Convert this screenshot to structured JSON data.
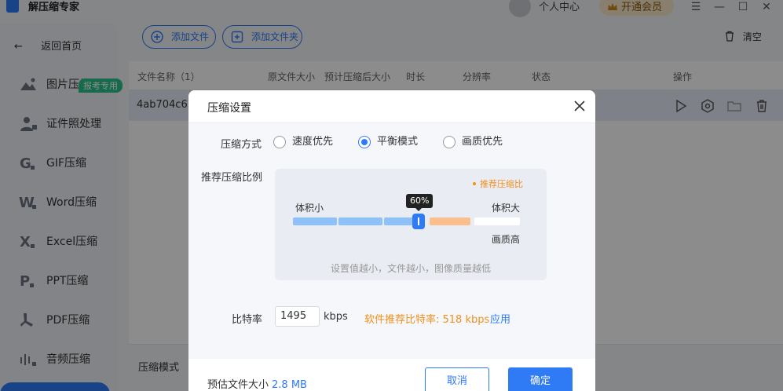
{
  "app": {
    "title": "解压缩专家",
    "user_center": "个人中心",
    "vip_label": "开通会员",
    "window_controls": [
      "menu-icon",
      "minimize-icon",
      "maximize-icon",
      "close-icon"
    ]
  },
  "sidebar": {
    "back_home": "返回首页",
    "items": [
      {
        "label": "图片压缩",
        "icon": "image-icon"
      },
      {
        "label": "证件照处理",
        "icon": "id-photo-icon",
        "badge": "报考专用"
      },
      {
        "label": "GIF压缩",
        "icon": "gif-icon"
      },
      {
        "label": "Word压缩",
        "icon": "word-icon"
      },
      {
        "label": "Excel压缩",
        "icon": "excel-icon"
      },
      {
        "label": "PPT压缩",
        "icon": "ppt-icon"
      },
      {
        "label": "PDF压缩",
        "icon": "pdf-icon"
      },
      {
        "label": "音频压缩",
        "icon": "audio-icon"
      }
    ]
  },
  "toolbar": {
    "add_file": "添加文件",
    "add_folder": "添加文件夹",
    "clear": "清空"
  },
  "table": {
    "headers": [
      "文件名称（1）",
      "原文件大小",
      "预计压缩后大小",
      "时长",
      "分辨率",
      "状态",
      "操作"
    ],
    "rows": [
      {
        "name": "4ab704c67"
      }
    ]
  },
  "bottom": {
    "mode_label": "压缩模式"
  },
  "dialog": {
    "title": "压缩设置",
    "method_label": "压缩方式",
    "methods": [
      "速度优先",
      "平衡模式",
      "画质优先"
    ],
    "method_selected": "平衡模式",
    "ratio_label": "推荐压缩比例",
    "ratio_legend": "推荐压缩比",
    "small_label": "体积小",
    "large_label": "体积大",
    "quality_label": "画质高",
    "ratio_value": "60%",
    "ratio_hint": "设置值越小，文件越小，图像质量越低",
    "bitrate_label": "比特率",
    "bitrate_value": "1495",
    "bitrate_unit": "kbps",
    "bitrate_recommend": "软件推荐比特率: 518 kbps",
    "apply_label": "应用",
    "estimate_label": "预估文件大小",
    "estimate_value": "2.8 MB",
    "cancel_label": "取消",
    "ok_label": "确定"
  },
  "colors": {
    "accent": "#2f7bf6",
    "recommend": "#f0901e",
    "slider_blue": "#8ec1f7",
    "slider_orange": "#fbbf8e"
  }
}
